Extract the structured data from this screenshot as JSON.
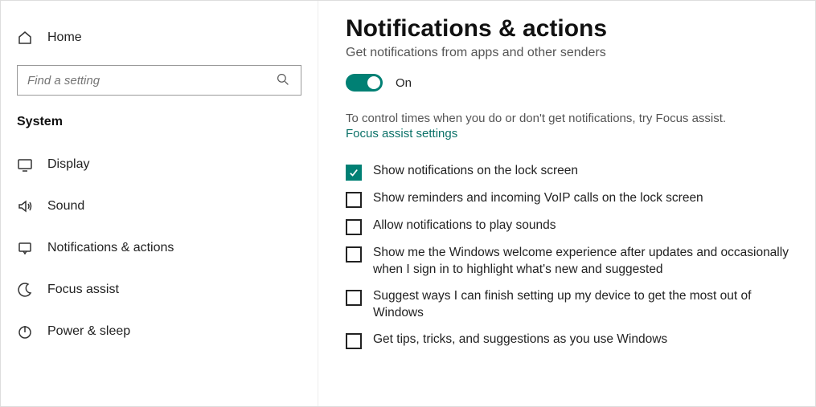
{
  "sidebar": {
    "home_label": "Home",
    "search_placeholder": "Find a setting",
    "section_label": "System",
    "items": [
      {
        "label": "Display"
      },
      {
        "label": "Sound"
      },
      {
        "label": "Notifications & actions"
      },
      {
        "label": "Focus assist"
      },
      {
        "label": "Power & sleep"
      }
    ]
  },
  "main": {
    "title": "Notifications & actions",
    "subhead": "Get notifications from apps and other senders",
    "toggle_label": "On",
    "helper_text": "To control times when you do or don't get notifications, try Focus assist.",
    "link_text": "Focus assist settings",
    "checkboxes": [
      {
        "label": "Show notifications on the lock screen",
        "checked": true
      },
      {
        "label": "Show reminders and incoming VoIP calls on the lock screen",
        "checked": false
      },
      {
        "label": "Allow notifications to play sounds",
        "checked": false
      },
      {
        "label": "Show me the Windows welcome experience after updates and occasionally when I sign in to highlight what's new and suggested",
        "checked": false
      },
      {
        "label": "Suggest ways I can finish setting up my device to get the most out of Windows",
        "checked": false
      },
      {
        "label": "Get tips, tricks, and suggestions as you use Windows",
        "checked": false
      }
    ]
  },
  "colors": {
    "accent": "#008074",
    "link": "#0b7168"
  }
}
